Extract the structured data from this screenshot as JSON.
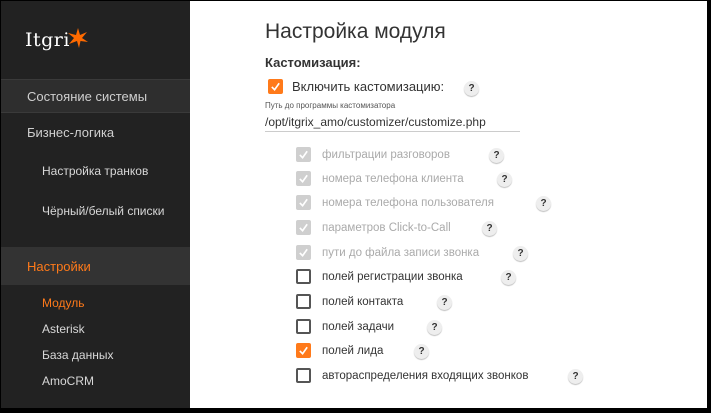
{
  "app": {
    "logo_text": "Itgri"
  },
  "sidebar": {
    "status": "Состояние системы",
    "business": "Бизнес-логика",
    "trunks": "Настройка транков",
    "blacklist": "Чёрный/белый списки",
    "settings": "Настройки",
    "module": "Модуль",
    "asterisk": "Asterisk",
    "database": "База данных",
    "amocrm": "AmoCRM"
  },
  "page": {
    "title": "Настройка модуля",
    "section": "Кастомизация:",
    "enable_label": "Включить кастомизацию:",
    "enable_checked": true,
    "help": "?",
    "path_label": "Путь до программы кастомизатора",
    "path_value": "/opt/itgrix_amo/customizer/customize.php"
  },
  "options": [
    {
      "label": "фильтрации разговоров",
      "checked": true,
      "disabled": true
    },
    {
      "label": "номера телефона клиента",
      "checked": true,
      "disabled": true
    },
    {
      "label": "номера телефона пользователя",
      "checked": true,
      "disabled": true
    },
    {
      "label": "параметров Click-to-Call",
      "checked": true,
      "disabled": true
    },
    {
      "label": "пути до файла записи звонка",
      "checked": true,
      "disabled": true
    },
    {
      "label": "полей регистрации звонка",
      "checked": false,
      "disabled": false
    },
    {
      "label": "полей контакта",
      "checked": false,
      "disabled": false
    },
    {
      "label": "полей задачи",
      "checked": false,
      "disabled": false
    },
    {
      "label": "полей лида",
      "checked": true,
      "disabled": false
    },
    {
      "label": "автораспределения входящих звонков",
      "checked": false,
      "disabled": false
    }
  ],
  "colors": {
    "accent": "#ff7a1a",
    "sidebar": "#222222",
    "disabled": "#cfcfcf"
  }
}
